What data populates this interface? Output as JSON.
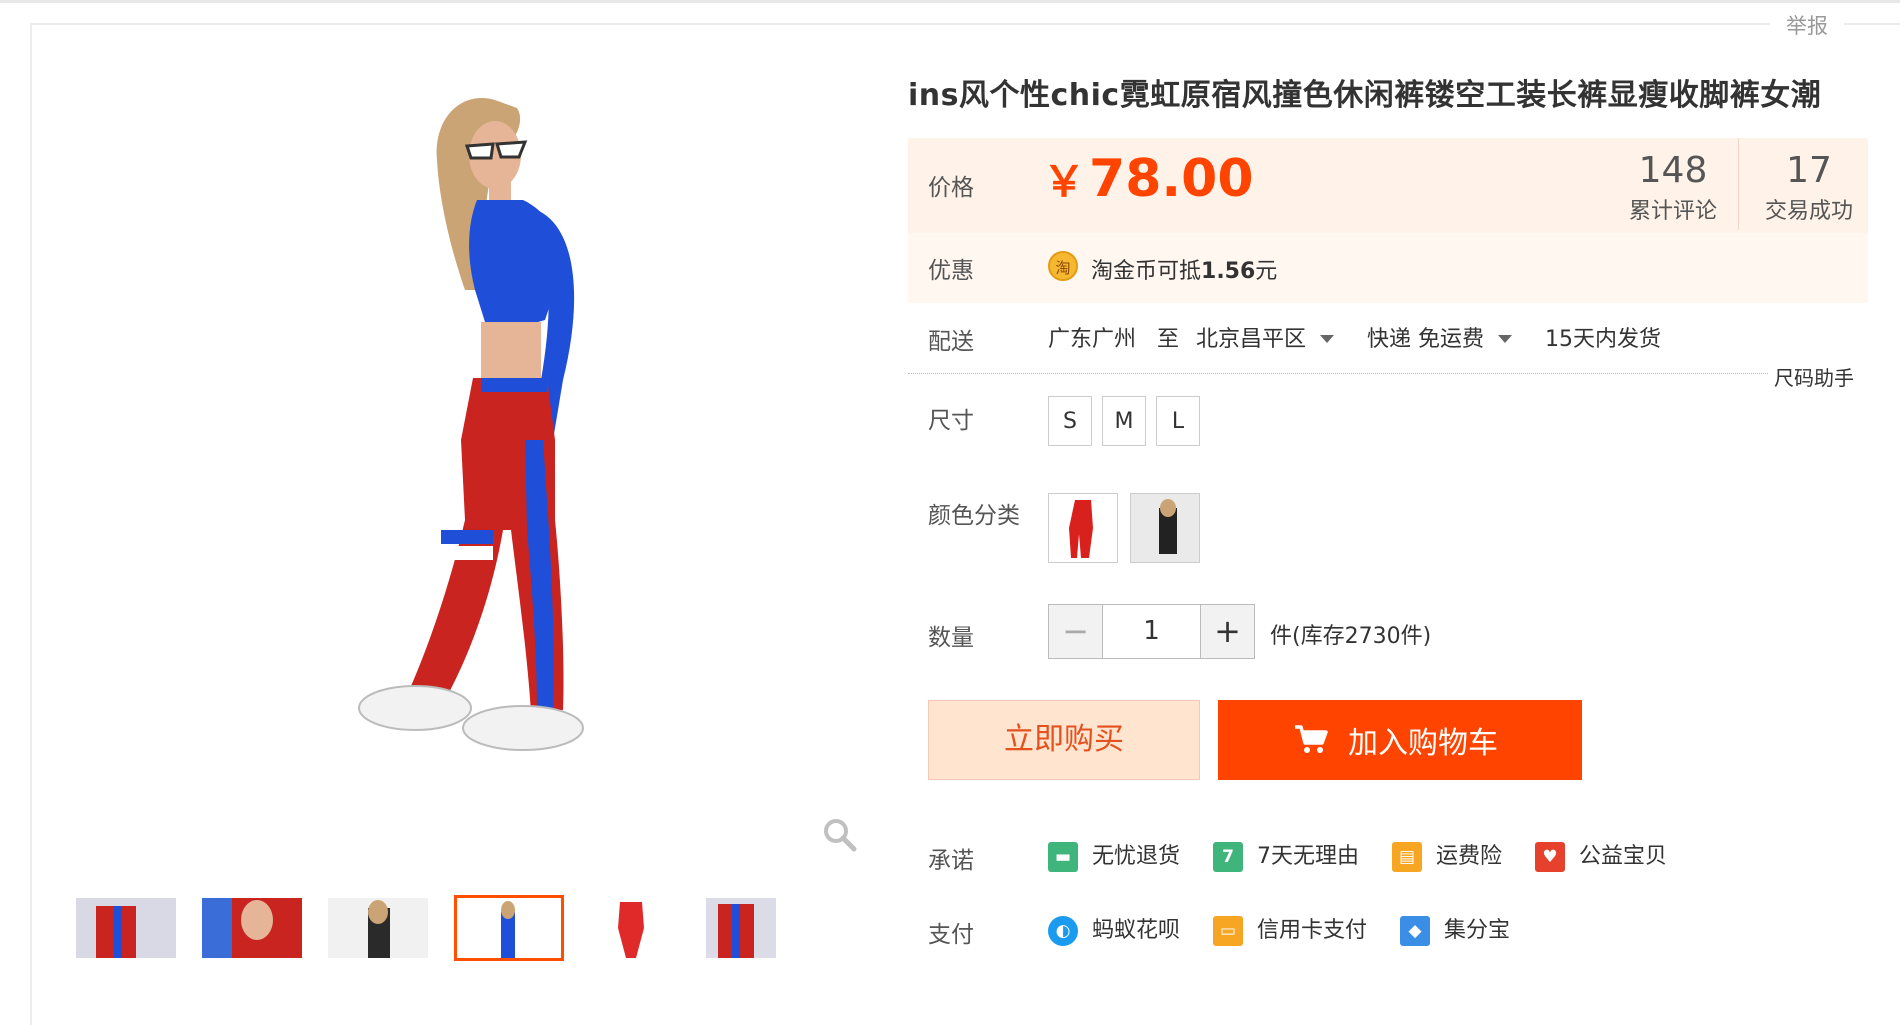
{
  "report_link": "举报",
  "product": {
    "title": "ins风个性chic霓虹原宿风撞色休闲裤镂空工装长裤显瘦收脚裤女潮"
  },
  "price": {
    "label": "价格",
    "currency": "￥",
    "value": "78.00",
    "color": "#ff4400"
  },
  "counters": {
    "reviews_count": "148",
    "reviews_label": "累计评论",
    "trades_count": "17",
    "trades_label": "交易成功"
  },
  "promotion": {
    "label": "优惠",
    "coin_char": "淘",
    "text_prefix": "淘金币可抵",
    "amount": "1.56",
    "unit": "元"
  },
  "shipping": {
    "label": "配送",
    "from": "广东广州",
    "to_word": "至",
    "destination": "北京昌平区",
    "method": "快递 免运费",
    "dispatch": "15天内发货"
  },
  "size_helper": "尺码助手",
  "size": {
    "label": "尺寸",
    "options": [
      "S",
      "M",
      "L"
    ]
  },
  "color_category": {
    "label": "颜色分类"
  },
  "quantity": {
    "label": "数量",
    "minus": "−",
    "value": "1",
    "plus": "+",
    "stock_text": "件(库存2730件)"
  },
  "buttons": {
    "buy_now": "立即购买",
    "add_to_cart": "加入购物车",
    "accent": "#ff4400"
  },
  "promises": {
    "label": "承诺",
    "items": [
      {
        "text": "无忧退货",
        "icon": "truck-icon",
        "color": "#3fb57c"
      },
      {
        "text": "7天无理由",
        "icon": "seven-day-icon",
        "color": "#3fb57c"
      },
      {
        "text": "运费险",
        "icon": "shipping-insurance-icon",
        "color": "#f6a623"
      },
      {
        "text": "公益宝贝",
        "icon": "charity-heart-icon",
        "color": "#e5412d"
      }
    ]
  },
  "payment": {
    "label": "支付",
    "items": [
      {
        "text": "蚂蚁花呗",
        "icon": "huabei-icon",
        "color": "#1a9bf0"
      },
      {
        "text": "信用卡支付",
        "icon": "credit-card-icon",
        "color": "#f6a623"
      },
      {
        "text": "集分宝",
        "icon": "jifenbao-icon",
        "color": "#3a8ee6"
      }
    ]
  }
}
